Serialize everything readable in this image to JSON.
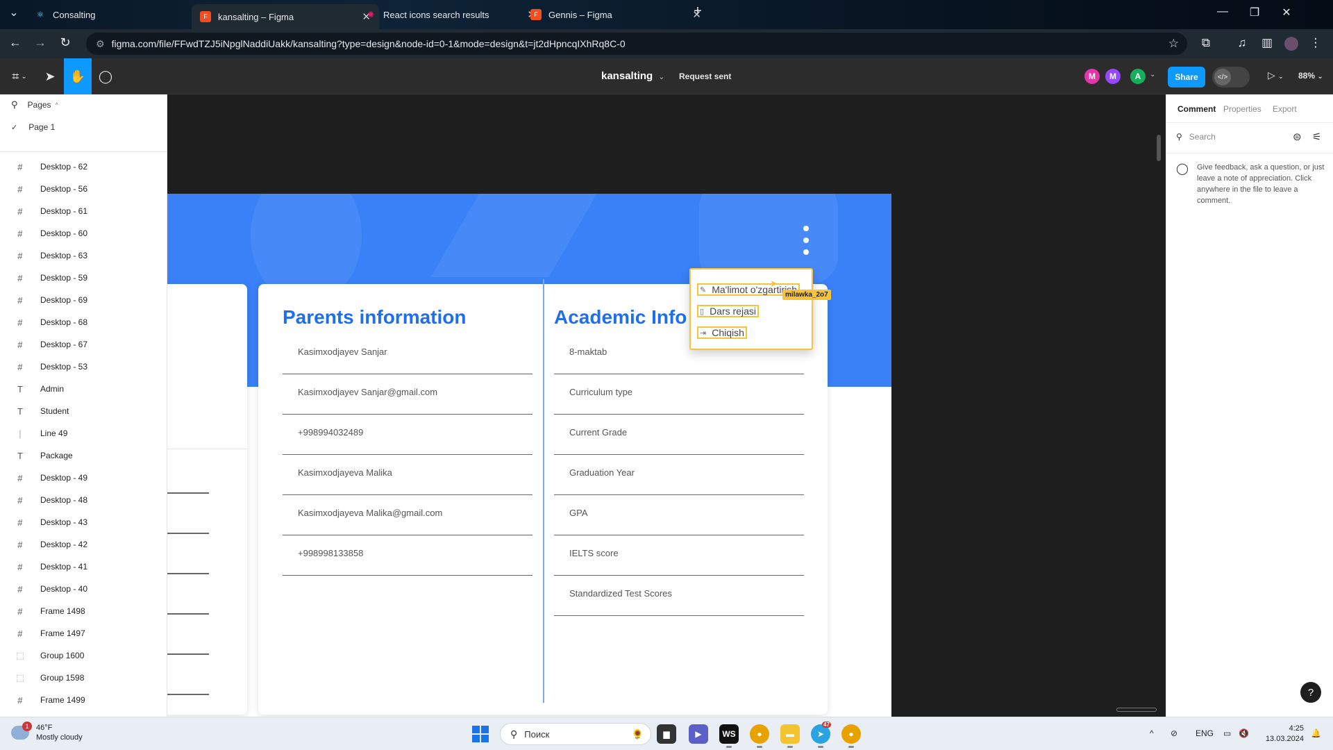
{
  "browser": {
    "tabs": [
      {
        "title": "Consalting",
        "active": false
      },
      {
        "title": "kansalting – Figma",
        "active": true
      },
      {
        "title": "React icons search results",
        "active": false
      },
      {
        "title": "Gennis – Figma",
        "active": false
      }
    ],
    "url": "figma.com/file/FFwdTZJ5iNpglNaddiUakk/kansalting?type=design&node-id=0-1&mode=design&t=jt2dHpncqIXhRq8C-0"
  },
  "figma": {
    "file_name": "kansalting",
    "status": "Request sent",
    "collaborators": [
      {
        "initial": "M",
        "color": "#e535ab"
      },
      {
        "initial": "M",
        "color": "#9747ff"
      },
      {
        "initial": "A",
        "color": "#14ae5c"
      }
    ],
    "share_label": "Share",
    "zoom": "88%"
  },
  "left_panel": {
    "pages_label": "Pages",
    "current_page": "Page 1",
    "layers": [
      {
        "name": "Desktop - 62",
        "type": "frame"
      },
      {
        "name": "Desktop - 56",
        "type": "frame"
      },
      {
        "name": "Desktop - 61",
        "type": "frame"
      },
      {
        "name": "Desktop - 60",
        "type": "frame"
      },
      {
        "name": "Desktop - 63",
        "type": "frame"
      },
      {
        "name": "Desktop - 59",
        "type": "frame"
      },
      {
        "name": "Desktop - 69",
        "type": "frame"
      },
      {
        "name": "Desktop - 68",
        "type": "frame"
      },
      {
        "name": "Desktop - 67",
        "type": "frame"
      },
      {
        "name": "Desktop - 53",
        "type": "frame"
      },
      {
        "name": "Admin",
        "type": "text"
      },
      {
        "name": "Student",
        "type": "text"
      },
      {
        "name": "Line 49",
        "type": "line"
      },
      {
        "name": "Package",
        "type": "text"
      },
      {
        "name": "Desktop - 49",
        "type": "frame"
      },
      {
        "name": "Desktop - 48",
        "type": "frame"
      },
      {
        "name": "Desktop - 43",
        "type": "frame"
      },
      {
        "name": "Desktop - 42",
        "type": "frame"
      },
      {
        "name": "Desktop - 41",
        "type": "frame"
      },
      {
        "name": "Desktop - 40",
        "type": "frame"
      },
      {
        "name": "Frame 1498",
        "type": "frame"
      },
      {
        "name": "Frame 1497",
        "type": "frame"
      },
      {
        "name": "Group 1600",
        "type": "group"
      },
      {
        "name": "Group 1598",
        "type": "group"
      },
      {
        "name": "Frame 1499",
        "type": "frame"
      }
    ]
  },
  "canvas": {
    "parents_title": "Parents information",
    "parents_fields": [
      "Kasimxodjayev Sanjar",
      "Kasimxodjayev Sanjar@gmail.com",
      "+998994032489",
      "Kasimxodjayeva Malika",
      "Kasimxodjayeva Malika@gmail.com",
      "+998998133858"
    ],
    "academic_title": "Academic Info",
    "academic_fields": [
      "8-maktab",
      "Curriculum type",
      "Current Grade",
      "Graduation Year",
      "GPA",
      "IELTS score",
      "Standardized Test Scores"
    ],
    "menu": [
      {
        "label": "Ma'limot o'zgartirish",
        "icon": "pencil-icon"
      },
      {
        "label": "Dars rejasi",
        "icon": "document-icon"
      },
      {
        "label": "Chiqish",
        "icon": "logout-icon"
      }
    ],
    "cursor_user": "milawka_2o7"
  },
  "right_panel": {
    "tabs": [
      "Comment",
      "Properties",
      "Export"
    ],
    "search_placeholder": "Search",
    "hint": "Give feedback, ask a question, or just leave a note of appreciation. Click anywhere in the file to leave a comment.",
    "help": "?"
  },
  "taskbar": {
    "temperature": "46°F",
    "weather": "Mostly cloudy",
    "weather_badge": "1",
    "search_placeholder": "Поиск",
    "language": "ENG",
    "time": "4:25",
    "date": "13.03.2024",
    "telegram_badge": "47"
  }
}
